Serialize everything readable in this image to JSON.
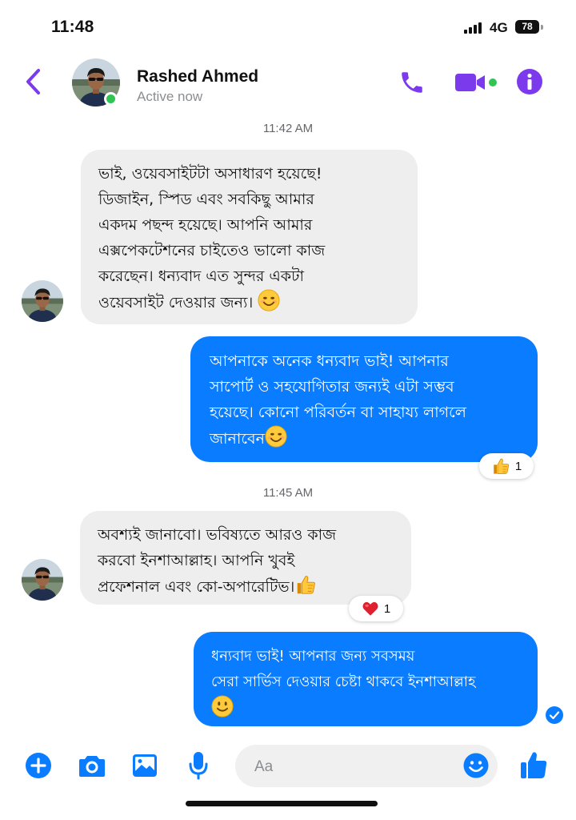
{
  "status_bar": {
    "time": "11:48",
    "network": "4G",
    "battery": "78"
  },
  "header": {
    "contact_name": "Rashed Ahmed",
    "contact_status": "Active now"
  },
  "messages": [
    {
      "type": "timestamp",
      "text": "11:42 AM"
    },
    {
      "type": "incoming",
      "lines": [
        "ভাই, ওয়েবসাইটটা অসাধারণ হয়েছে!",
        "ডিজাইন, স্পিড এবং সবকিছু আমার",
        "একদম পছন্দ হয়েছে। আপনি আমার",
        "এক্সপেকটেশনের চাইতেও ভালো কাজ",
        "করেছেন। ধন্যবাদ এত সুন্দর একটা",
        "ওয়েবসাইট দেওয়ার জন্য।"
      ],
      "emoji": "smiling-face-emoji"
    },
    {
      "type": "outgoing",
      "lines": [
        "আপনাকে অনেক ধন্যবাদ ভাই! আপনার",
        "সাপোর্ট ও সহযোগিতার জন্যই এটা সম্ভব",
        "হয়েছে। কোনো পরিবর্তন বা সাহায্য লাগলে",
        "জানাবেন"
      ],
      "emoji": "smiling-face-emoji",
      "reaction": {
        "icon": "thumbs-up-emoji",
        "count": "1"
      }
    },
    {
      "type": "timestamp",
      "text": "11:45 AM"
    },
    {
      "type": "incoming",
      "lines": [
        "অবশ্যই জানাবো। ভবিষ্যতে আরও কাজ",
        "করবো ইনশাআল্লাহ। আপনি খুবই",
        "প্রফেশনাল এবং কো-অপারেটিভ।"
      ],
      "emoji": "thumbs-up-emoji",
      "reaction": {
        "icon": "red-heart-emoji",
        "count": "1"
      }
    },
    {
      "type": "outgoing",
      "lines": [
        "ধন্যবাদ ভাই! আপনার জন্য সবসময়",
        "সেরা সার্ভিস দেওয়ার চেষ্টা থাকবে ইনশাআল্লাহ"
      ],
      "emoji": "slightly-smiling-face-emoji"
    }
  ],
  "composer": {
    "placeholder": "Aa"
  },
  "colors": {
    "accent": "#7c3aed",
    "bubble_outgoing": "#0a7cff",
    "bubble_incoming": "#eeeeee",
    "composer_icons": "#0a7cff",
    "online": "#31c453"
  }
}
